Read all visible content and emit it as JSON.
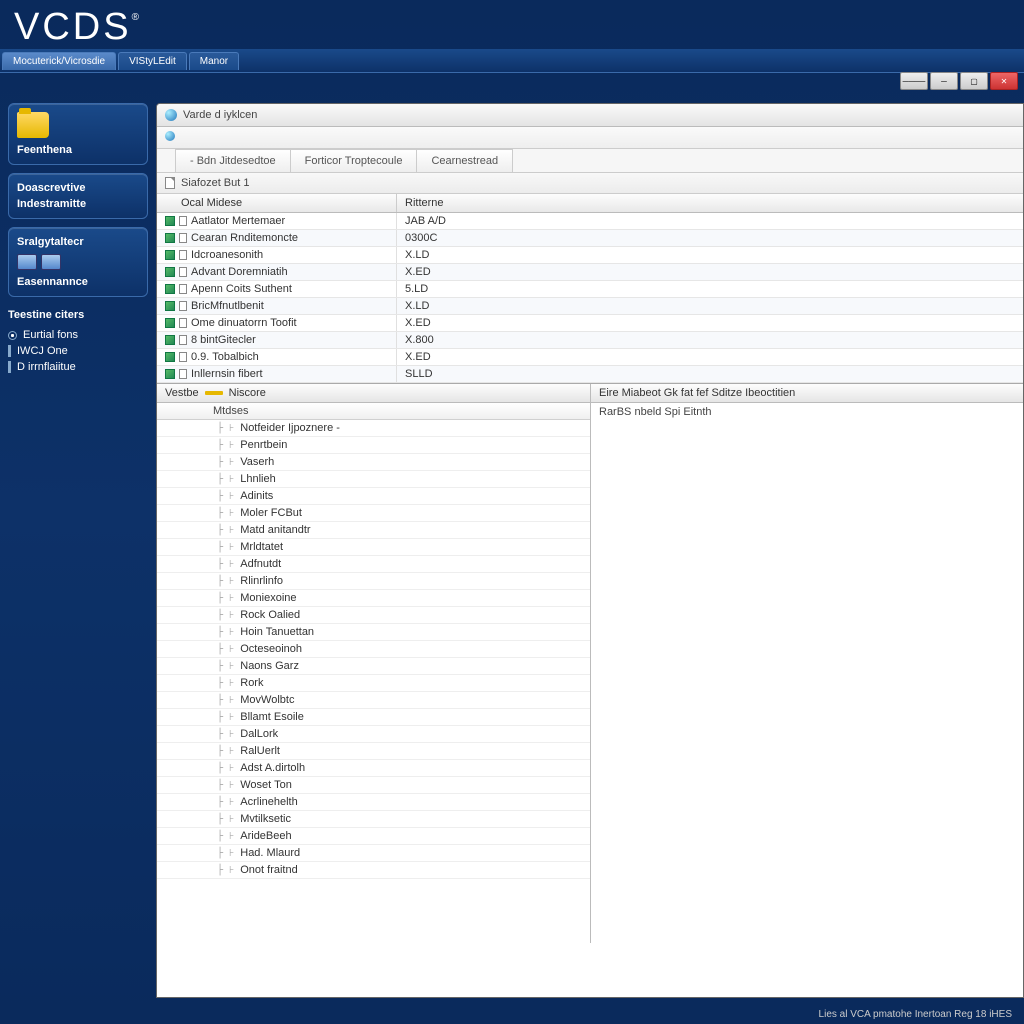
{
  "app": {
    "logo": "VCDS"
  },
  "topTabs": [
    "Mocuterick/Vicrosdie",
    "VIStyLEdit",
    "Manor"
  ],
  "winControls": {
    "min": "────",
    "max": "▢",
    "close": "✕"
  },
  "sidebar": {
    "panel1_label": "Feenthena",
    "panel2_items": [
      "Doascrevtive",
      "Indestramitte"
    ],
    "panel3_title": "Sralgytaltecr",
    "panel3_label": "Easennannce",
    "panel4_title": "Teestine citers",
    "panel4_items": [
      {
        "label": "Eurtial fons",
        "sel": true
      },
      {
        "label": "IWCJ One",
        "sel": false
      },
      {
        "label": "D irrnflaiitue",
        "sel": false
      }
    ]
  },
  "main": {
    "title": "Varde d iyklcen",
    "toolbar_globe": "",
    "tabs": [
      "- Bdn Jitdesedtoe",
      "Forticor Troptecoule",
      "Cearnestread"
    ],
    "section_hdr": "Siafozet But 1",
    "grid_cols": [
      "Ocal Midese",
      "Ritterne"
    ],
    "grid_rows": [
      {
        "name": "Aatlator Mertemaer",
        "val": "JAB A/D"
      },
      {
        "name": "Cearan Rnditemoncte",
        "val": "0300C"
      },
      {
        "name": "Idcroanesonith",
        "val": "X.LD"
      },
      {
        "name": "Advant Doremniatih",
        "val": "X.ED"
      },
      {
        "name": "Apenn Coits Suthent",
        "val": "5.LD"
      },
      {
        "name": "BricMfnutlbenit",
        "val": "X.LD"
      },
      {
        "name": "Ome dinuatorrn Toofit",
        "val": "X.ED"
      },
      {
        "name": "8 bintGitecler",
        "val": "X.800"
      },
      {
        "name": "0.9. Tobalbich",
        "val": "X.ED"
      },
      {
        "name": "Inllernsin fibert",
        "val": "SLLD"
      }
    ],
    "lower_left_hdr": "Vestbe —— Niscore",
    "lower_left_sub": "Mtdses",
    "lower_right_hdr": "Eire Miabeot Gk fat fef Sditze Ibeoctitien",
    "lower_right_body": "RarBS nbeld  Spi Eitnth",
    "tree": [
      "Notfeider Ijpoznere -",
      "Penrtbein",
      "Vaserh",
      "Lhnlieh",
      "Adinits",
      "Moler FCBut",
      "Matd anitandtr",
      "Mrldtatet",
      "Adfnutdt",
      "Rlinrlinfo",
      "Moniexoine",
      "Rock Oalied",
      "Hoin Tanuettan",
      "Octeseoinoh",
      "Naons Garz",
      "Rork",
      "MovWolbtc",
      "Bllamt Esoile",
      "DalLork",
      "RalUerlt",
      "Adst A.dirtolh",
      "Woset Ton",
      "Acrlinehelth",
      "Mvtilksetic",
      "ArideBeeh",
      "Had. Mlaurd",
      "Onot fraitnd"
    ]
  },
  "status": "Lies al VCA pmatohe Inertoan Reg 18 iHES"
}
